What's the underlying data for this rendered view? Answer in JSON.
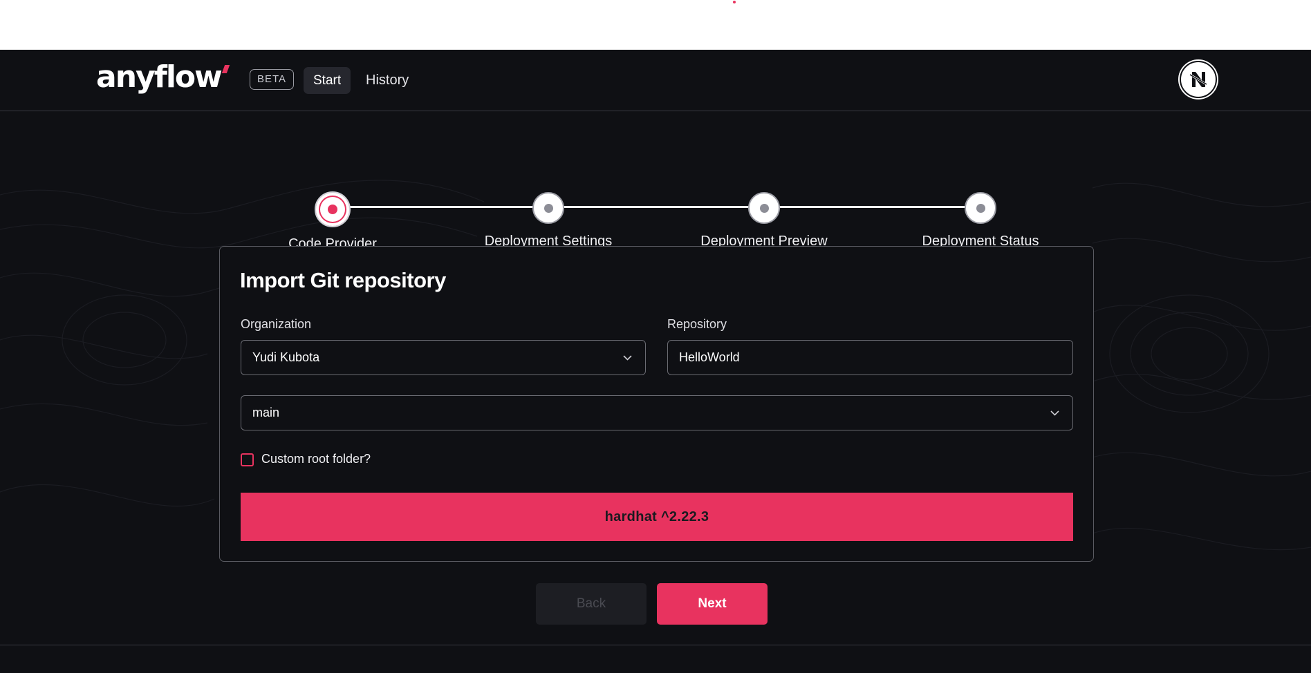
{
  "brand": {
    "logo_text": "anyflow",
    "beta_label": "BETA",
    "accent_color": "#e8335f"
  },
  "nav": {
    "items": [
      {
        "label": "Start",
        "active": true
      },
      {
        "label": "History",
        "active": false
      }
    ]
  },
  "user": {
    "avatar_icon": "nft-avatar-icon"
  },
  "stepper": {
    "current_step": 1,
    "steps": [
      {
        "label": "Code Provider"
      },
      {
        "label": "Deployment Settings"
      },
      {
        "label": "Deployment Preview"
      },
      {
        "label": "Deployment Status"
      }
    ]
  },
  "card": {
    "title": "Import Git repository",
    "organization": {
      "label": "Organization",
      "value": "Yudi Kubota"
    },
    "repository": {
      "label": "Repository",
      "value": "HelloWorld"
    },
    "branch": {
      "value": "main"
    },
    "custom_root": {
      "label": "Custom root folder?",
      "checked": false
    },
    "framework_banner": "hardhat ^2.22.3"
  },
  "actions": {
    "back_label": "Back",
    "next_label": "Next",
    "back_disabled": true
  }
}
